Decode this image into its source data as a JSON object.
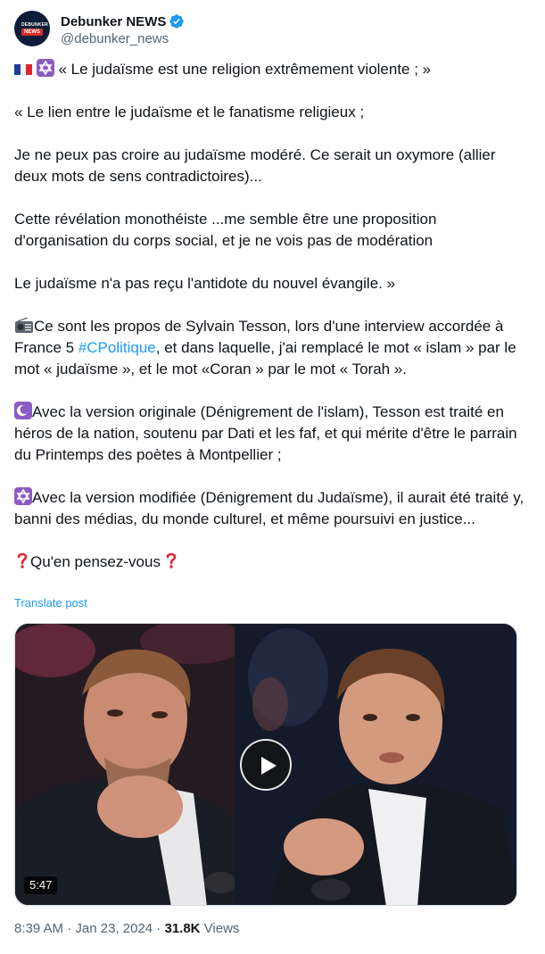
{
  "author": {
    "display_name": "Debunker NEWS",
    "handle": "@debunker_news",
    "avatar_text_top": "DEBUNKER",
    "avatar_text_box": "NEWS",
    "verified": true
  },
  "post": {
    "lines": [
      {
        "prefix": "",
        "text": " « Le judaïsme est une religion extrêmement violente ; »"
      },
      {
        "text": ""
      },
      {
        "text": "« Le lien entre le judaïsme et le fanatisme religieux ;"
      },
      {
        "text": ""
      },
      {
        "text": "Je ne peux pas croire au judaïsme modéré. Ce serait un oxymore (allier deux mots de sens contradictoires)..."
      },
      {
        "text": ""
      },
      {
        "text": "Cette révélation monothéiste ...me semble être une proposition d'organisation du corps social, et je ne vois pas de modération"
      },
      {
        "text": ""
      },
      {
        "text": "Le judaïsme n'a pas reçu l'antidote du nouvel évangile. »"
      },
      {
        "text": ""
      },
      {
        "text_before_link": "Ce sont les propos de Sylvain Tesson, lors d'une interview accordée à France 5 ",
        "link": "#CPolitique",
        "text_after_link": ",  et dans laquelle, j'ai remplacé le mot « islam »  par le mot « judaïsme », et le mot «Coran » par le mot « Torah »."
      },
      {
        "text": ""
      },
      {
        "text": "Avec la version originale (Dénigrement de l'islam), Tesson est traité en héros de la nation, soutenu par Dati et les faf, et qui mérite d'être le parrain du Printemps des poètes à Montpellier ;"
      },
      {
        "text": ""
      },
      {
        "text": "Avec la version modifiée (Dénigrement du Judaïsme), il aurait été traité y, banni des médias, du monde culturel, et même poursuivi en justice..."
      },
      {
        "text": ""
      },
      {
        "text": "Qu'en pensez-vous "
      }
    ],
    "translate_label": "Translate post"
  },
  "media": {
    "duration": "5:47"
  },
  "meta": {
    "time": "8:39 AM",
    "separator1": " · ",
    "date": "Jan 23, 2024",
    "separator2": " · ",
    "views_count": "31.8K",
    "views_label": " Views"
  },
  "colors": {
    "accent": "#1d9bf0",
    "text_primary": "#0f1419",
    "text_secondary": "#536471"
  },
  "icons": [
    "verified-badge-icon",
    "france-flag-icon",
    "star-of-david-icon",
    "radio-icon",
    "crescent-icon",
    "question-mark-icon",
    "play-icon"
  ]
}
